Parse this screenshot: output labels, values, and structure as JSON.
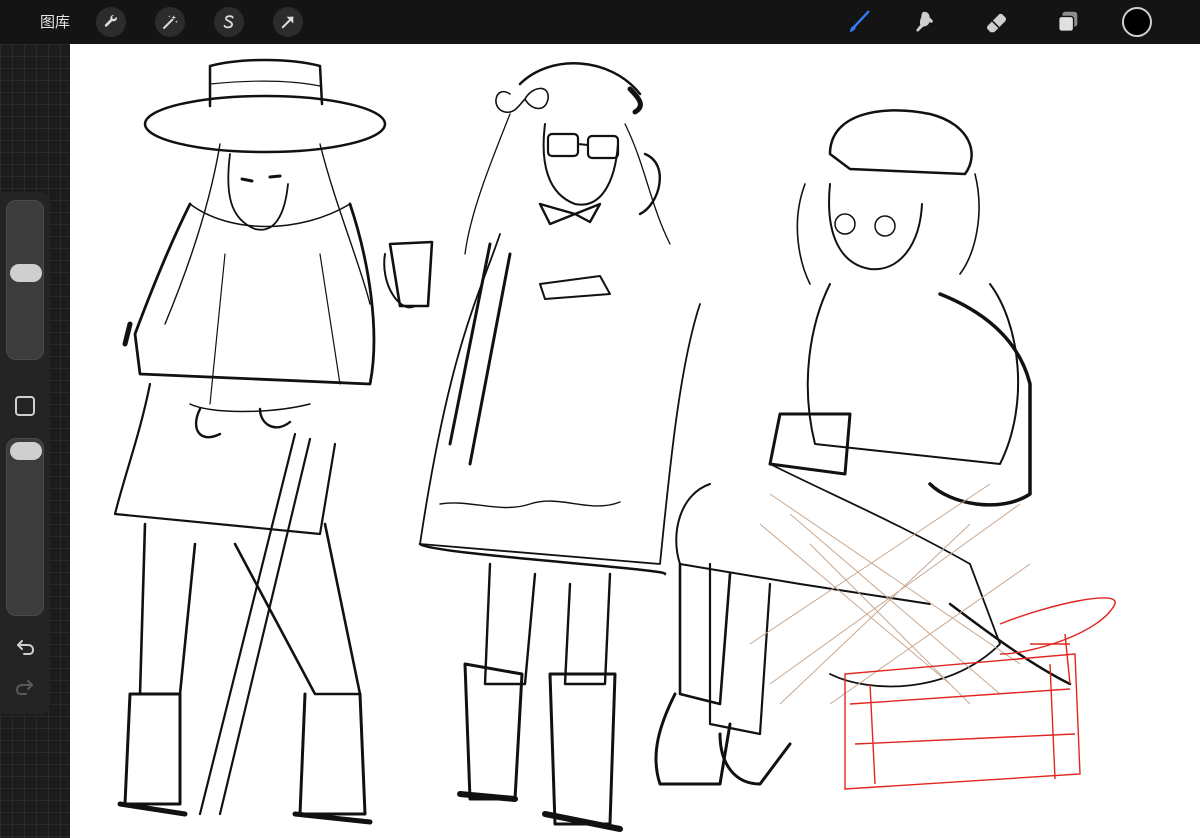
{
  "toolbar": {
    "gallery_label": "图库",
    "left_tools": [
      {
        "name": "actions",
        "icon": "wrench-icon"
      },
      {
        "name": "adjustments",
        "icon": "magic-wand-icon"
      },
      {
        "name": "selection",
        "icon": "selection-s-icon"
      },
      {
        "name": "transform",
        "icon": "arrow-cursor-icon"
      }
    ],
    "right_tools": [
      {
        "name": "brush",
        "icon": "brush-icon",
        "active": true
      },
      {
        "name": "smudge",
        "icon": "smudge-icon"
      },
      {
        "name": "eraser",
        "icon": "eraser-icon"
      },
      {
        "name": "layers",
        "icon": "layers-icon"
      }
    ],
    "current_color": "#000000",
    "accent_color": "#2f7cf6"
  },
  "sidebar": {
    "brush_size_level": 0.55,
    "opacity_level": 0.0,
    "undo_icon": "undo-icon",
    "redo_icon": "redo-icon"
  }
}
